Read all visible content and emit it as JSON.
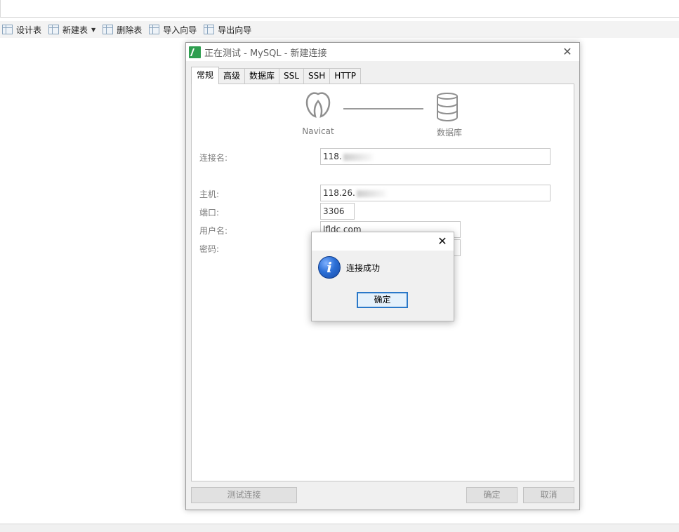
{
  "toolbar": {
    "items": [
      {
        "label": "设计表"
      },
      {
        "label": "新建表"
      },
      {
        "label": "删除表"
      },
      {
        "label": "导入向导"
      },
      {
        "label": "导出向导"
      }
    ]
  },
  "dialog": {
    "title": "正在测试 - MySQL - 新建连接",
    "tabs": [
      "常规",
      "高级",
      "数据库",
      "SSL",
      "SSH",
      "HTTP"
    ],
    "active_tab": "常规",
    "diagram": {
      "left_label": "Navicat",
      "right_label": "数据库"
    },
    "form": {
      "connection_name_label": "连接名:",
      "connection_name_value": "118.",
      "host_label": "主机:",
      "host_value": "118.26.",
      "port_label": "端口:",
      "port_value": "3306",
      "username_label": "用户名:",
      "username_value": "lfldc com",
      "password_label": "密码:"
    },
    "buttons": {
      "test": "测试连接",
      "ok": "确定",
      "cancel": "取消"
    }
  },
  "msgbox": {
    "message": "连接成功",
    "ok": "确定"
  },
  "colors": {
    "accent": "#2a78c8",
    "app_icon": "#2e9e4f"
  }
}
